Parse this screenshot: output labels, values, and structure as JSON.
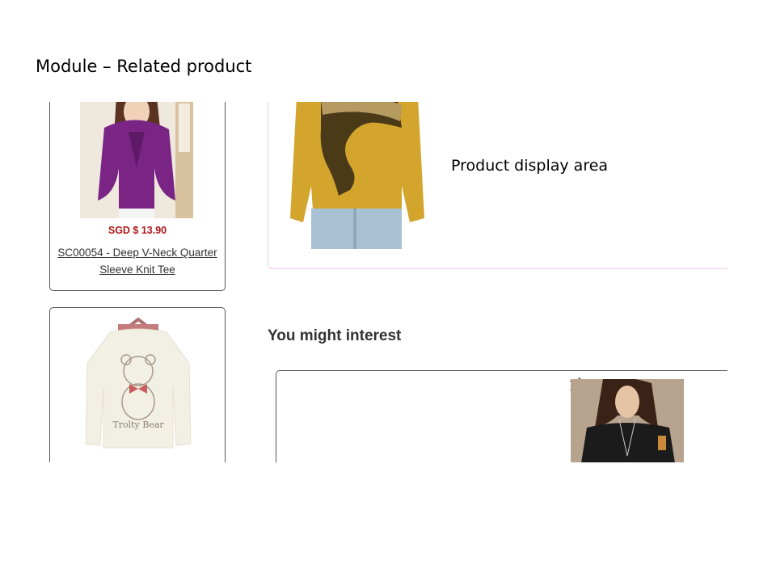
{
  "slide": {
    "title": "Module – Related product"
  },
  "related_products": [
    {
      "price": "SGD $ 13.90",
      "name_line1": "SC00054 - Deep V-Neck Quarter",
      "name_line2": "Sleeve Knit Tee"
    },
    {
      "print_text": "Trolty Bear"
    }
  ],
  "display": {
    "label": "Product display area"
  },
  "suggestions": {
    "heading": "You might interest",
    "banner_text": "yle"
  },
  "colors": {
    "price": "#b01515",
    "display_border": "#f0c8ef",
    "purple_shirt": "#7a2586",
    "mustard_top": "#d3a52c"
  }
}
